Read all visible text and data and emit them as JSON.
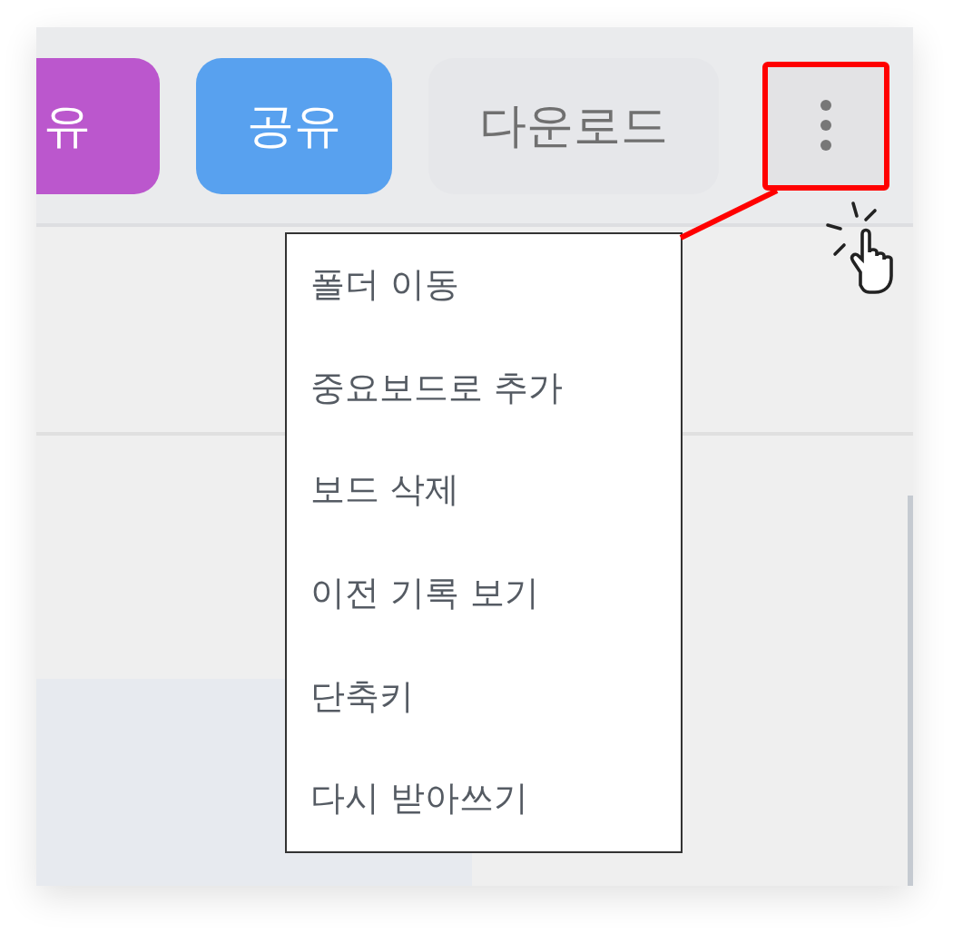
{
  "toolbar": {
    "buttons": [
      {
        "label": "유",
        "color": "#bb57cd"
      },
      {
        "label": "공유",
        "color": "#58a1ef"
      },
      {
        "label": "다운로드",
        "color": "#e6e7ea"
      }
    ],
    "more_button": {
      "highlighted": true
    }
  },
  "menu": {
    "items": [
      "폴더 이동",
      "중요보드로 추가",
      "보드 삭제",
      "이전 기록 보기",
      "단축키",
      "다시 받아쓰기"
    ]
  }
}
